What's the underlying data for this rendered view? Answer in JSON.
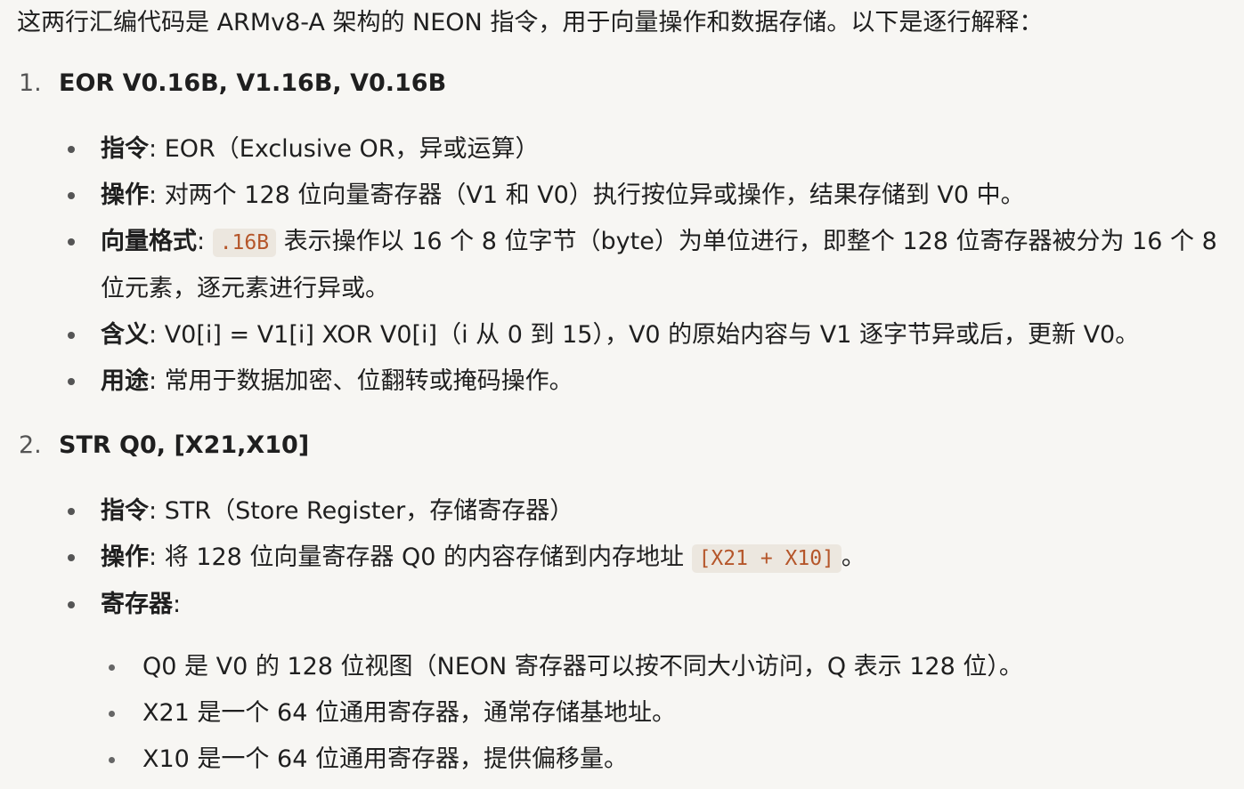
{
  "intro": "这两行汇编代码是 ARMv8-A 架构的 NEON 指令，用于向量操作和数据存储。以下是逐行解释：",
  "sections": [
    {
      "number": "1.",
      "heading": "EOR V0.16B, V1.16B, V0.16B",
      "items": [
        {
          "term": "指令",
          "sep": ": ",
          "text": "EOR（Exclusive OR，异或运算）"
        },
        {
          "term": "操作",
          "sep": ": ",
          "text": "对两个 128 位向量寄存器（V1 和 V0）执行按位异或操作，结果存储到 V0 中。"
        },
        {
          "term": "向量格式",
          "sep": ": ",
          "code": ".16B",
          "text_after": " 表示操作以 16 个 8 位字节（byte）为单位进行，即整个 128 位寄存器被分为 16 个 8 位元素，逐元素进行异或。"
        },
        {
          "term": "含义",
          "sep": ": ",
          "text": "V0[i] = V1[i] XOR V0[i]（i 从 0 到 15），V0 的原始内容与 V1 逐字节异或后，更新 V0。"
        },
        {
          "term": "用途",
          "sep": ": ",
          "text": "常用于数据加密、位翻转或掩码操作。"
        }
      ]
    },
    {
      "number": "2.",
      "heading": "STR Q0, [X21,X10]",
      "items": [
        {
          "term": "指令",
          "sep": ": ",
          "text": "STR（Store Register，存储寄存器）"
        },
        {
          "term": "操作",
          "sep": ": ",
          "text": "将 128 位向量寄存器 Q0 的内容存储到内存地址 ",
          "code": "[X21 + X10]",
          "text_after": "。"
        },
        {
          "term": "寄存器",
          "sep": ":"
        }
      ],
      "sub_items": [
        "Q0 是 V0 的 128 位视图（NEON 寄存器可以按不同大小访问，Q 表示 128 位）。",
        "X21 是一个 64 位通用寄存器，通常存储基地址。",
        "X10 是一个 64 位通用寄存器，提供偏移量。"
      ]
    }
  ]
}
